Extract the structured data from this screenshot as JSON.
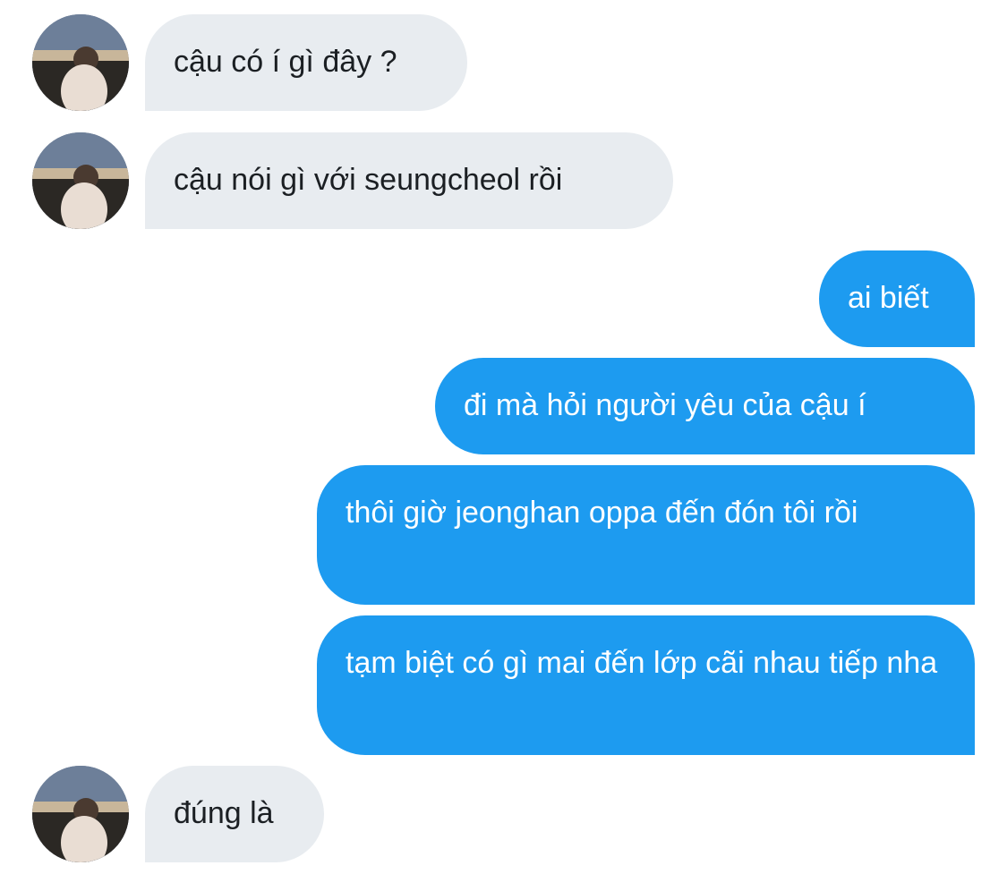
{
  "conversation": {
    "messages": [
      {
        "direction": "incoming",
        "text": "cậu có í gì đây ?"
      },
      {
        "direction": "incoming",
        "text": "cậu nói gì với seungcheol rồi"
      },
      {
        "direction": "outgoing",
        "text": "ai biết"
      },
      {
        "direction": "outgoing",
        "text": "đi mà hỏi người yêu của cậu í"
      },
      {
        "direction": "outgoing",
        "text": "thôi giờ jeonghan oppa đến đón tôi rồi"
      },
      {
        "direction": "outgoing",
        "text": "tạm biệt có gì mai đến lớp cãi nhau tiếp nha"
      },
      {
        "direction": "incoming",
        "text": "đúng là"
      }
    ]
  },
  "colors": {
    "incoming_bubble": "#e8ecf0",
    "outgoing_bubble": "#1d9bf0",
    "incoming_text": "#1b1f23",
    "outgoing_text": "#ffffff"
  }
}
